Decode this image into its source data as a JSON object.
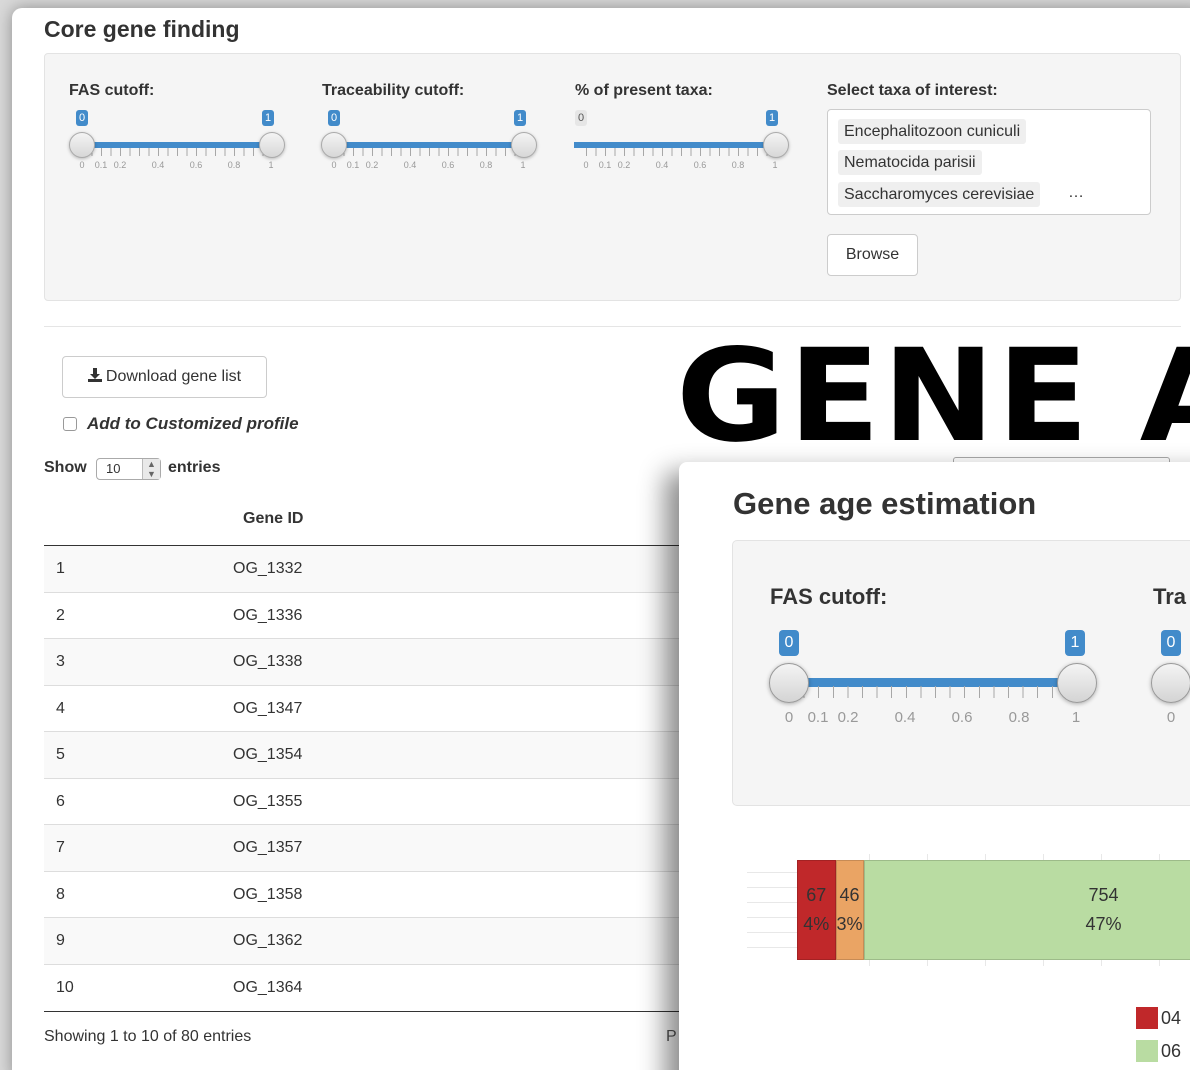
{
  "back_window": {
    "title": "Core gene finding",
    "filters": {
      "fas_label": "FAS cutoff:",
      "trace_label": "Traceability cutoff:",
      "present_label": "% of present taxa:",
      "taxa_label": "Select taxa of interest:"
    },
    "sliders": [
      {
        "name": "fas",
        "min": "0",
        "max": "1",
        "low": 0,
        "high": 1,
        "min_color": "blue"
      },
      {
        "name": "traceability",
        "min": "0",
        "max": "1",
        "low": 0,
        "high": 1,
        "min_color": "blue"
      },
      {
        "name": "present-taxa",
        "min": "0",
        "max": "1",
        "low": 0,
        "high": 1,
        "min_color": "grey"
      }
    ],
    "tick_labels": [
      "0",
      "0.1",
      "0.2",
      "0.4",
      "0.6",
      "0.8",
      "1"
    ],
    "taxa": [
      "Encephalitozoon cuniculi",
      "Nematocida parisii",
      "Saccharomyces cerevisiae"
    ],
    "taxa_more": "…",
    "browse_label": "Browse",
    "download_label": "Download gene list",
    "add_profile_label": "Add to Customized profile",
    "show_label": "Show",
    "entries_value": "10",
    "entries_label": "entries",
    "table": {
      "header": "Gene ID",
      "rows": [
        {
          "n": "1",
          "id": "OG_1332"
        },
        {
          "n": "2",
          "id": "OG_1336"
        },
        {
          "n": "3",
          "id": "OG_1338"
        },
        {
          "n": "4",
          "id": "OG_1347"
        },
        {
          "n": "5",
          "id": "OG_1354"
        },
        {
          "n": "6",
          "id": "OG_1355"
        },
        {
          "n": "7",
          "id": "OG_1357"
        },
        {
          "n": "8",
          "id": "OG_1358"
        },
        {
          "n": "9",
          "id": "OG_1362"
        },
        {
          "n": "10",
          "id": "OG_1364"
        }
      ]
    },
    "footer": "Showing 1 to 10 of 80 entries",
    "pager_partial": "P"
  },
  "headline": "GENE A",
  "front_window": {
    "title": "Gene age estimation",
    "fas_label": "FAS cutoff:",
    "trace_label_partial": "Tra",
    "slider": {
      "min": "0",
      "max": "1",
      "low": 0,
      "high": 1
    },
    "second_slider_min": "0",
    "tick_labels": [
      "0",
      "0.1",
      "0.2",
      "0.4",
      "0.6",
      "0.8",
      "1"
    ],
    "second_tick_label": "0"
  },
  "chart_data": {
    "type": "bar",
    "orientation": "horizontal-stacked",
    "series": [
      {
        "count": 67,
        "percent": "4%",
        "color": "#c0282a"
      },
      {
        "count": 46,
        "percent": "3%",
        "color": "#eaa464"
      },
      {
        "count": 754,
        "percent": "47%",
        "color": "#b9dca2"
      }
    ],
    "labels": [
      {
        "count": "67",
        "percent": "4%"
      },
      {
        "count": "46",
        "percent": "3%"
      },
      {
        "count": "754",
        "percent": "47%"
      }
    ],
    "legend": [
      {
        "text": "04",
        "color": "#c0282a"
      },
      {
        "text": "06",
        "color": "#b9dca2"
      }
    ]
  }
}
